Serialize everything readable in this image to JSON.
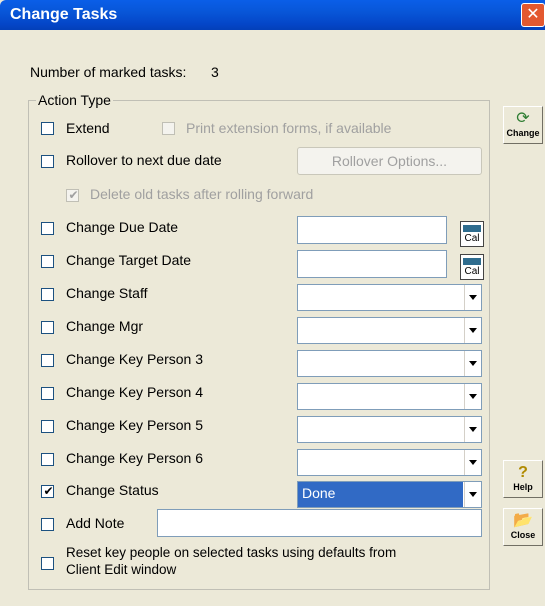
{
  "window": {
    "title": "Change Tasks",
    "close": "✕"
  },
  "marked": {
    "label": "Number of marked tasks:",
    "count": "3"
  },
  "group": {
    "title": "Action Type"
  },
  "extend": {
    "label": "Extend",
    "checked": false
  },
  "print_forms": {
    "label": "Print extension forms, if available",
    "enabled": false
  },
  "rollover": {
    "label": "Rollover to next due date",
    "checked": false,
    "button": "Rollover Options..."
  },
  "delete_old": {
    "label": "Delete old tasks after rolling forward",
    "checked": true,
    "enabled": false
  },
  "calendar_icon": {
    "name": "calendar-icon",
    "text": "Cal"
  },
  "rows": {
    "due_date": {
      "label": "Change Due Date",
      "value": ""
    },
    "target_date": {
      "label": "Change Target Date",
      "value": ""
    },
    "staff": {
      "label": "Change Staff",
      "value": ""
    },
    "mgr": {
      "label": "Change Mgr",
      "value": ""
    },
    "kp3": {
      "label": "Change Key Person 3",
      "value": ""
    },
    "kp4": {
      "label": "Change Key Person 4",
      "value": ""
    },
    "kp5": {
      "label": "Change Key Person 5",
      "value": ""
    },
    "kp6": {
      "label": "Change Key Person 6",
      "value": ""
    },
    "status": {
      "label": "Change Status",
      "value": "Done",
      "checked": true
    }
  },
  "add_note": {
    "label": "Add Note",
    "value": ""
  },
  "reset": {
    "line1": "Reset key people on selected tasks using defaults from",
    "line2": "Client Edit window"
  },
  "side": {
    "change": {
      "label": "Change",
      "icon": "refresh-icon"
    },
    "help": {
      "label": "Help",
      "icon": "help-icon"
    },
    "close": {
      "label": "Close",
      "icon": "folder-open-icon"
    }
  }
}
